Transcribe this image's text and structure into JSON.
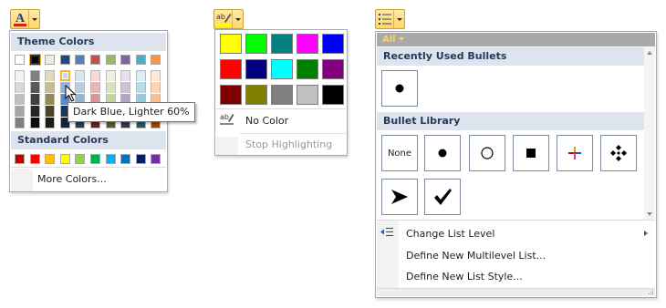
{
  "font_color_gallery": {
    "theme_colors_label": "Theme Colors",
    "standard_colors_label": "Standard Colors",
    "more_colors_label": "More Colors...",
    "tooltip": "Dark Blue, Lighter 60%",
    "theme_base": [
      "#ffffff",
      "#000000",
      "#eeece1",
      "#1f497d",
      "#4f81bd",
      "#c0504d",
      "#9bbb59",
      "#8064a2",
      "#4bacc6",
      "#f79646"
    ],
    "theme_shades": [
      [
        "#f2f2f2",
        "#d8d8d8",
        "#bfbfbf",
        "#a5a5a5",
        "#7f7f7f"
      ],
      [
        "#7f7f7f",
        "#595959",
        "#3f3f3f",
        "#262626",
        "#0c0c0c"
      ],
      [
        "#ddd9c3",
        "#c4bd97",
        "#938953",
        "#494429",
        "#1d1b10"
      ],
      [
        "#c6d9f0",
        "#8db3e2",
        "#548dd4",
        "#17365d",
        "#0f243e"
      ],
      [
        "#dbe5f1",
        "#b8cce4",
        "#95b3d7",
        "#366092",
        "#244061"
      ],
      [
        "#f2dcdb",
        "#e5b9b7",
        "#d99694",
        "#953734",
        "#632423"
      ],
      [
        "#ebf1dd",
        "#d7e3bc",
        "#c3d69b",
        "#76923c",
        "#4f6128"
      ],
      [
        "#e5e0ec",
        "#ccc1d9",
        "#b2a2c7",
        "#5f497a",
        "#3f3151"
      ],
      [
        "#dbeef3",
        "#b7dde8",
        "#92cddc",
        "#31859b",
        "#205867"
      ],
      [
        "#fdeada",
        "#fbd5b5",
        "#fac08f",
        "#e36c09",
        "#974806"
      ]
    ],
    "standard": [
      "#c00000",
      "#ff0000",
      "#ffc000",
      "#ffff00",
      "#92d050",
      "#00b050",
      "#00b0f0",
      "#0070c0",
      "#002060",
      "#7030a0"
    ]
  },
  "highlight_gallery": {
    "colors": [
      "#ffff00",
      "#00ff00",
      "#008080",
      "#ff00ff",
      "#0000ff",
      "#ff0000",
      "#000080",
      "#00ffff",
      "#008000",
      "#800080",
      "#800000",
      "#808000",
      "#808080",
      "#c0c0c0",
      "#000000"
    ],
    "no_color_label": "No Color",
    "stop_highlighting_label": "Stop Highlighting"
  },
  "bullet_gallery": {
    "filter_label": "All",
    "recently_used_label": "Recently Used Bullets",
    "library_label": "Bullet Library",
    "none_label": "None",
    "change_list_level_label": "Change List Level",
    "define_multilevel_label": "Define New Multilevel List...",
    "define_list_style_label": "Define New List Style..."
  },
  "icons": {
    "font_color": "font-color-icon",
    "highlight": "text-highlight-icon",
    "bullets": "bullets-icon"
  },
  "accent": "#f2b33a"
}
